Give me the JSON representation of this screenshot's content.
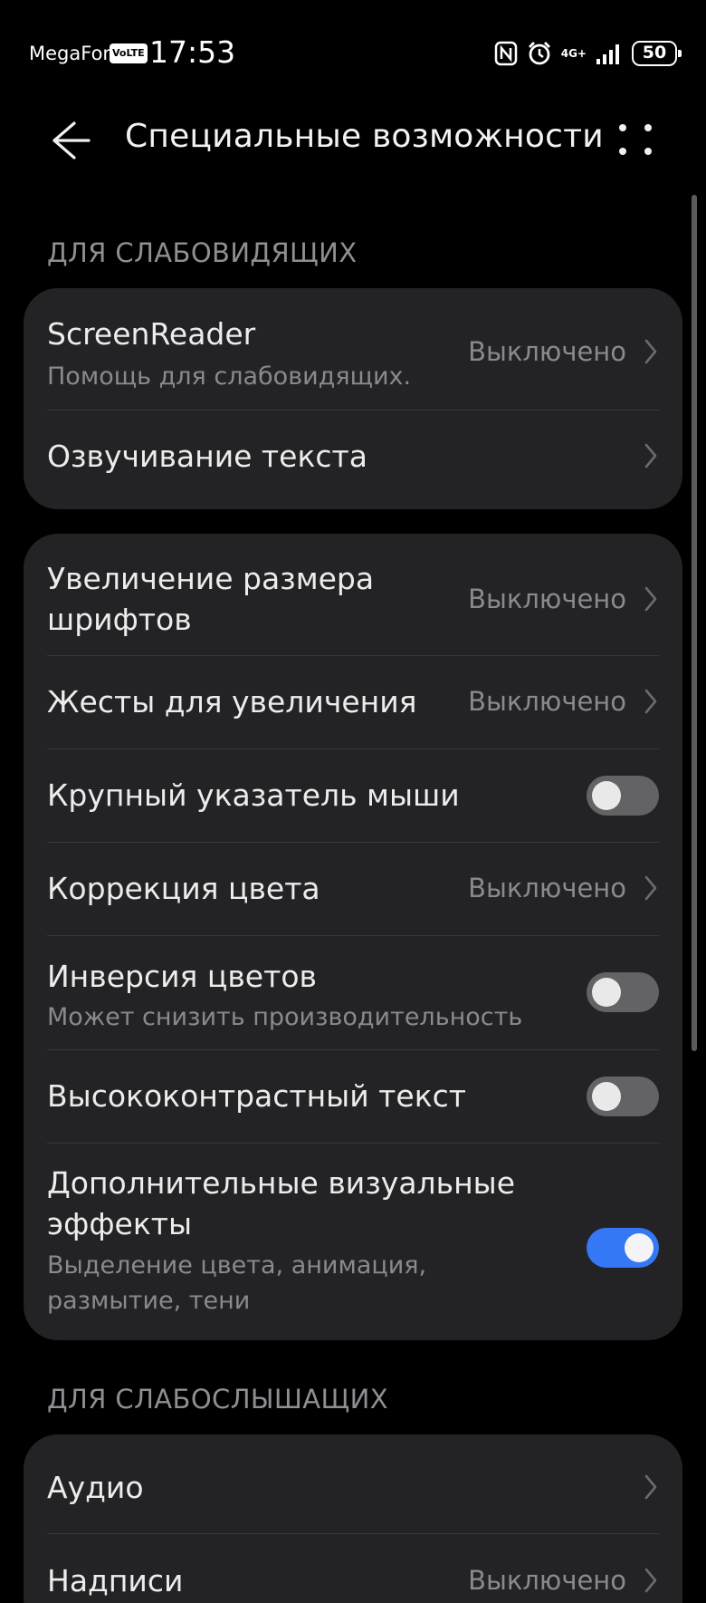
{
  "status_bar": {
    "carrier": "MegaFon",
    "volte": "VoLTE",
    "time": "17:53",
    "network": "4G+",
    "battery": "50"
  },
  "header": {
    "title": "Специальные возможности",
    "back_icon": "arrow-left-icon",
    "more_icon": "more-dots-icon"
  },
  "sections": {
    "vision_header": "ДЛЯ СЛАБОВИДЯЩИХ",
    "hearing_header": "ДЛЯ СЛАБОСЛЫШАЩИХ"
  },
  "card1": {
    "screenreader": {
      "label": "ScreenReader",
      "sub": "Помощь для слабовидящих.",
      "value": "Выключено"
    },
    "tts": {
      "label": "Озвучивание текста"
    }
  },
  "card2": {
    "font_size": {
      "label_line1": "Увеличение размера",
      "label_line2": "шрифтов",
      "value": "Выключено"
    },
    "magnify": {
      "label": "Жесты для увеличения",
      "value": "Выключено"
    },
    "pointer": {
      "label": "Крупный указатель мыши",
      "enabled": false
    },
    "color_correction": {
      "label": "Коррекция цвета",
      "value": "Выключено"
    },
    "inversion": {
      "label": "Инверсия цветов",
      "sub": "Может снизить производительность",
      "enabled": false
    },
    "high_contrast": {
      "label": "Высококонтрастный текст",
      "enabled": false
    },
    "visual_effects": {
      "label_line1": "Дополнительные визуальные",
      "label_line2": "эффекты",
      "sub_line1": "Выделение цвета, анимация,",
      "sub_line2": "размытие, тени",
      "enabled": true
    }
  },
  "card3": {
    "audio": {
      "label": "Аудио"
    },
    "captions": {
      "label": "Надписи",
      "value": "Выключено"
    }
  },
  "colors": {
    "background": "#000000",
    "card": "#232325",
    "accent": "#3478f6",
    "secondary_text": "#8a8a8e"
  }
}
